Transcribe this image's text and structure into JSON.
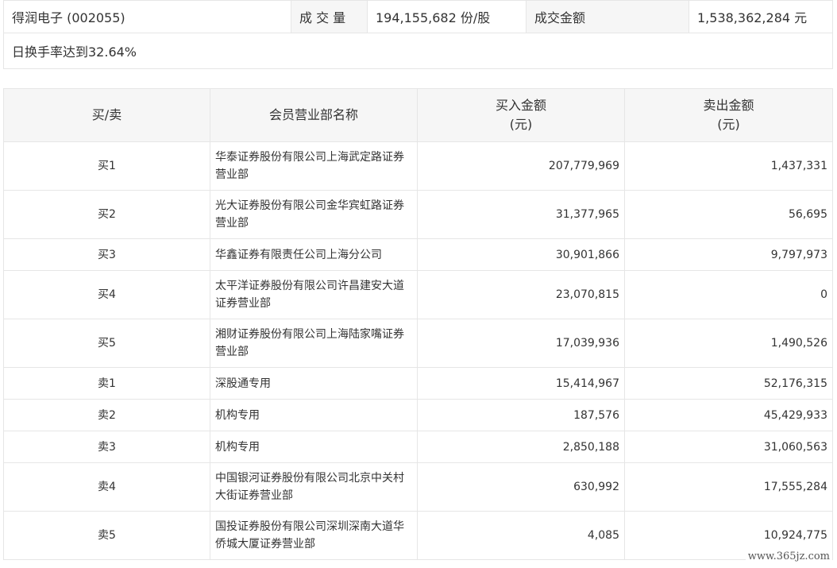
{
  "summary": {
    "stock_name": "得润电子 (002055)",
    "volume_label": "成 交 量",
    "volume_value": "194,155,682 份/股",
    "amount_label": "成交金额",
    "amount_value": "1,538,362,284 元",
    "turnover_note": "日换手率达到32.64%"
  },
  "table": {
    "headers": {
      "type": "买/卖",
      "member": "会员营业部名称",
      "buy_line1": "买入金额",
      "buy_line2": "(元)",
      "sell_line1": "卖出金额",
      "sell_line2": "(元)"
    },
    "rows": [
      {
        "type": "买1",
        "name": "华泰证券股份有限公司上海武定路证券营业部",
        "buy": "207,779,969",
        "sell": "1,437,331"
      },
      {
        "type": "买2",
        "name": "光大证券股份有限公司金华宾虹路证券营业部",
        "buy": "31,377,965",
        "sell": "56,695"
      },
      {
        "type": "买3",
        "name": "华鑫证券有限责任公司上海分公司",
        "buy": "30,901,866",
        "sell": "9,797,973"
      },
      {
        "type": "买4",
        "name": "太平洋证券股份有限公司许昌建安大道证券营业部",
        "buy": "23,070,815",
        "sell": "0"
      },
      {
        "type": "买5",
        "name": "湘财证券股份有限公司上海陆家嘴证券营业部",
        "buy": "17,039,936",
        "sell": "1,490,526"
      },
      {
        "type": "卖1",
        "name": "深股通专用",
        "buy": "15,414,967",
        "sell": "52,176,315"
      },
      {
        "type": "卖2",
        "name": "机构专用",
        "buy": "187,576",
        "sell": "45,429,933"
      },
      {
        "type": "卖3",
        "name": "机构专用",
        "buy": "2,850,188",
        "sell": "31,060,563"
      },
      {
        "type": "卖4",
        "name": "中国银河证券股份有限公司北京中关村大街证券营业部",
        "buy": "630,992",
        "sell": "17,555,284"
      },
      {
        "type": "卖5",
        "name": "国投证券股份有限公司深圳深南大道华侨城大厦证券营业部",
        "buy": "4,085",
        "sell": "10,924,775"
      }
    ]
  },
  "watermark": "www.365jz.com"
}
